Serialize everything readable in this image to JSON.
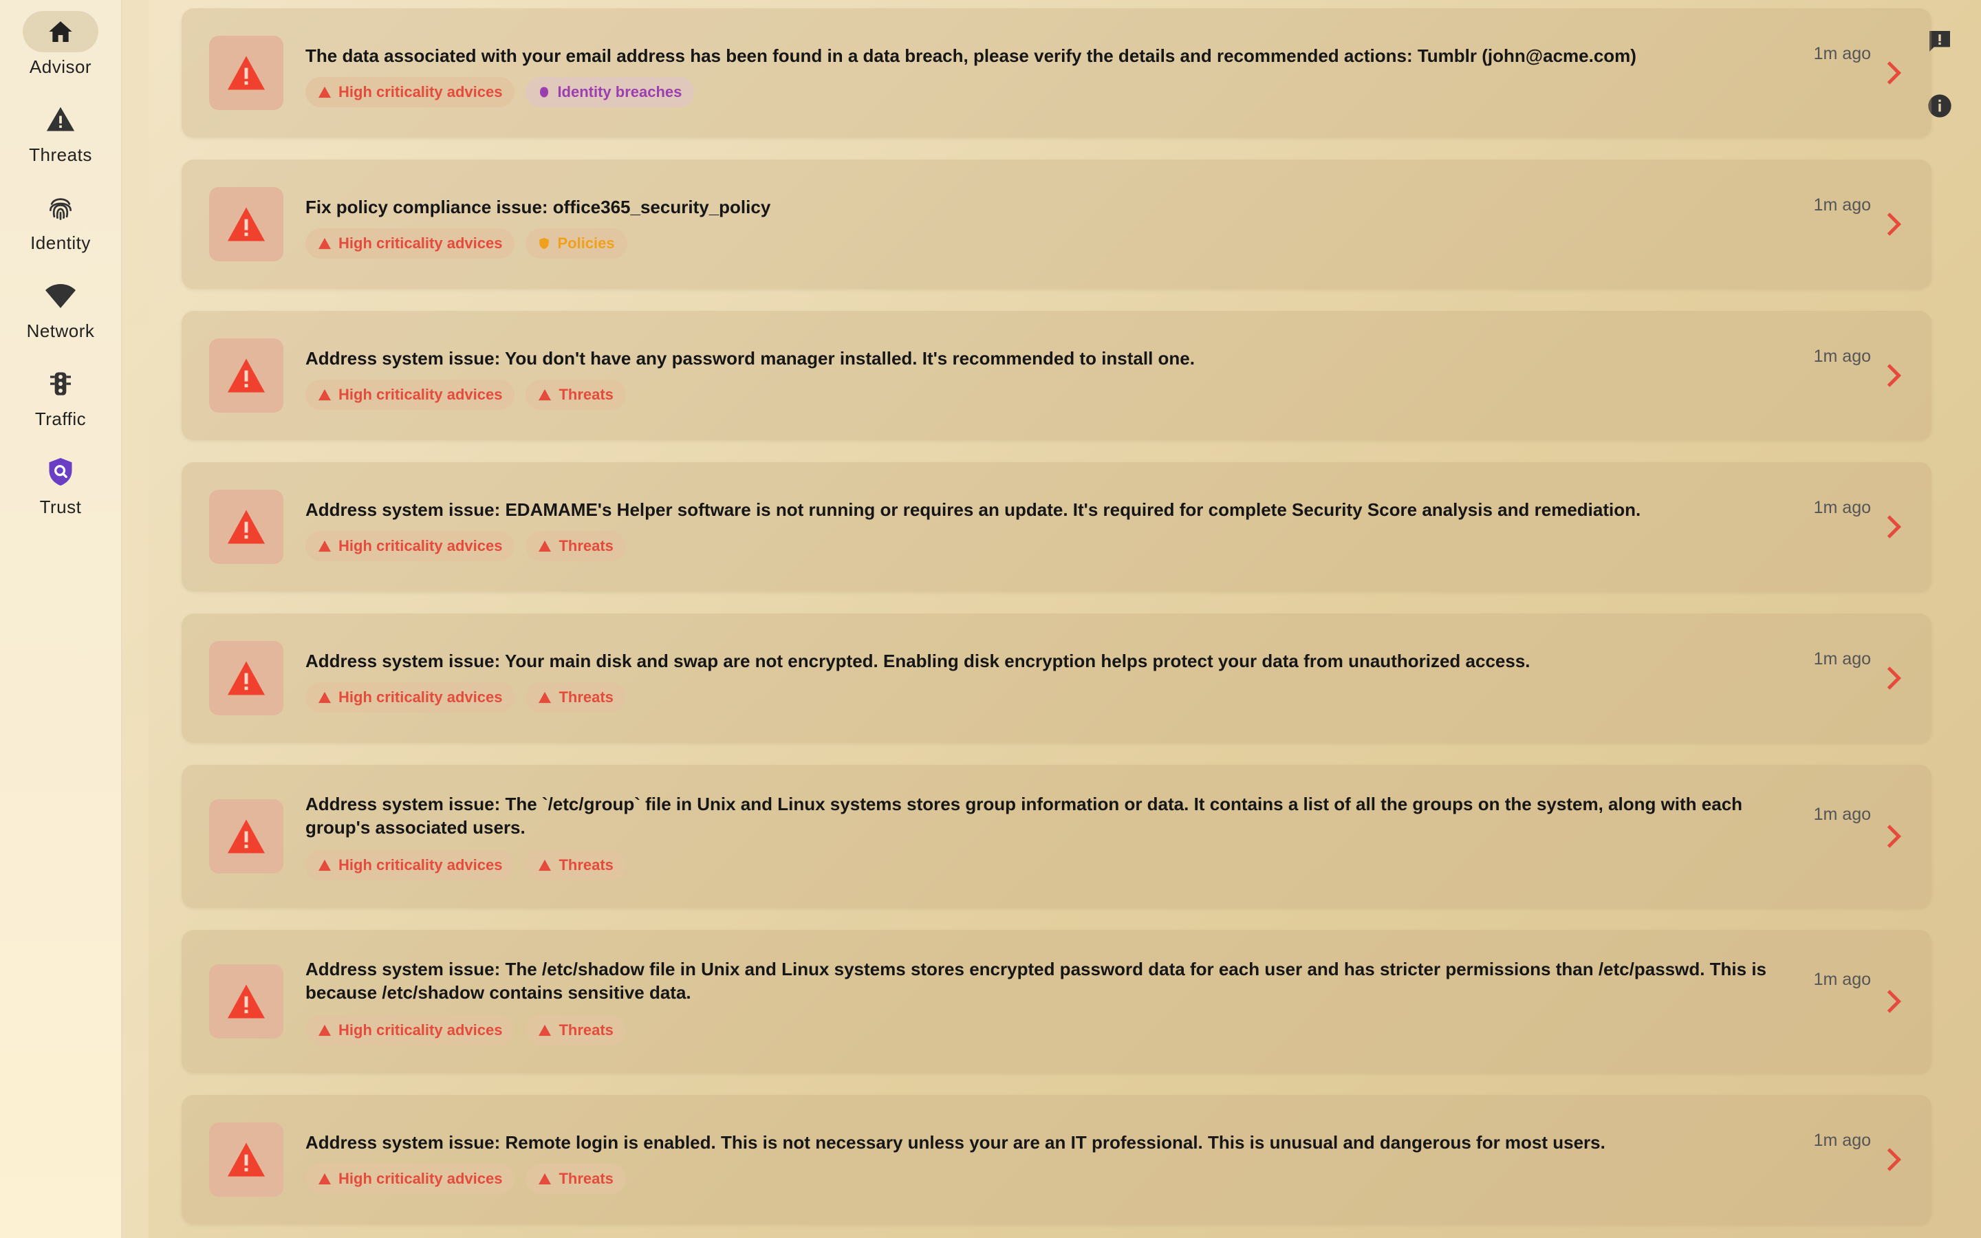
{
  "sidebar": {
    "items": [
      {
        "label": "Advisor",
        "icon": "home-icon",
        "active": true
      },
      {
        "label": "Threats",
        "icon": "warning-icon",
        "active": false
      },
      {
        "label": "Identity",
        "icon": "fingerprint-icon",
        "active": false
      },
      {
        "label": "Network",
        "icon": "wifi-icon",
        "active": false
      },
      {
        "label": "Traffic",
        "icon": "traffic-light-icon",
        "active": false
      },
      {
        "label": "Trust",
        "icon": "shield-search-icon",
        "active": false
      }
    ]
  },
  "tools": {
    "feedback_icon": "feedback-icon",
    "info_icon": "info-icon"
  },
  "tag_labels": {
    "crit": "High criticality advices",
    "breach": "Identity breaches",
    "policy": "Policies",
    "threat": "Threats"
  },
  "advices": [
    {
      "title": "The data associated with your email address has been found in a data breach, please verify the details and recommended actions: Tumblr (john@acme.com)",
      "time": "1m ago",
      "category": "breach"
    },
    {
      "title": "Fix policy compliance issue: office365_security_policy",
      "time": "1m ago",
      "category": "policy"
    },
    {
      "title": "Address system issue: You don't have any password manager installed. It's recommended to install one.",
      "time": "1m ago",
      "category": "threat"
    },
    {
      "title": "Address system issue: EDAMAME's Helper software is not running or requires an update. It's required for complete Security Score analysis and remediation.",
      "time": "1m ago",
      "category": "threat"
    },
    {
      "title": "Address system issue: Your main disk and swap are not encrypted. Enabling disk encryption helps protect your data from unauthorized access.",
      "time": "1m ago",
      "category": "threat"
    },
    {
      "title": "Address system issue: The `/etc/group` file in Unix and Linux systems stores group information or data. It contains a list of all the groups on the system, along with each group's associated users.",
      "time": "1m ago",
      "category": "threat"
    },
    {
      "title": "Address system issue: The /etc/shadow file in Unix and Linux systems stores encrypted password data for each user and has stricter permissions than /etc/passwd. This is because /etc/shadow contains sensitive data.",
      "time": "1m ago",
      "category": "threat"
    },
    {
      "title": "Address system issue: Remote login is enabled. This is not necessary unless your are an IT professional. This is unusual and dangerous for most users.",
      "time": "1m ago",
      "category": "threat"
    }
  ],
  "colors": {
    "accent": "#e54b3c",
    "breach": "#9b3fb0",
    "policy": "#f0a11c"
  }
}
